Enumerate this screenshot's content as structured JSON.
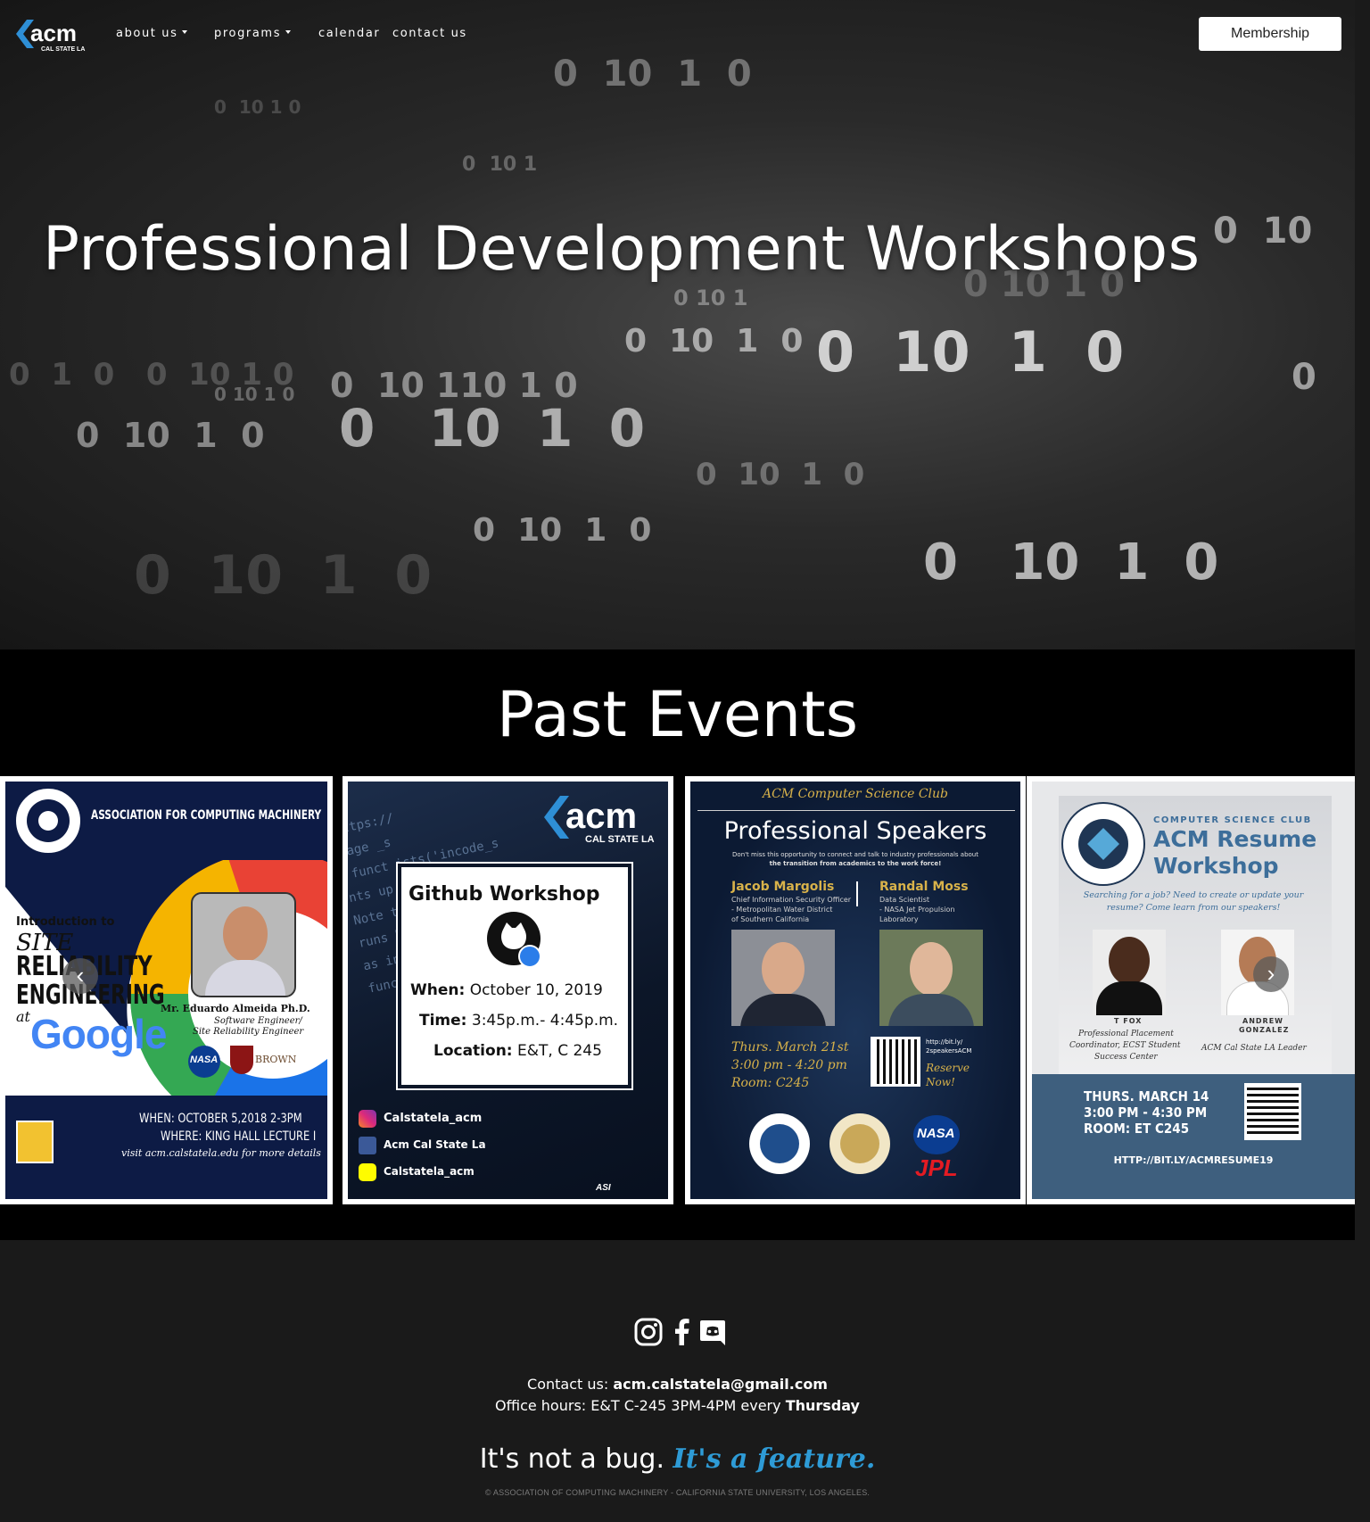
{
  "nav": {
    "logo_text": "acm",
    "logo_sub": "CAL STATE LA",
    "about": "about us",
    "programs": "programs",
    "calendar": "calendar",
    "contact": "contact us",
    "membership": "Membership"
  },
  "hero": {
    "title": "Professional Development Workshops"
  },
  "events": {
    "title": "Past Events",
    "posters": [
      {
        "org": "ASSOCIATION FOR COMPUTING MACHINERY",
        "intro": "Introduction to",
        "line1": "SITE",
        "line2": "RELIABILITY",
        "line3": "ENGINEERING",
        "at": "at",
        "company": "Google",
        "speaker": "Mr. Eduardo Almeida Ph.D.",
        "role1": "Software Engineer/",
        "role2": "Site Reliability Engineer",
        "nasa": "NASA",
        "brown": "BROWN",
        "when": "WHEN: OCTOBER 5,2018 2-3PM",
        "where": "WHERE: KING HALL LECTURE I",
        "visit": "visit acm.calstatela.edu for more details"
      },
      {
        "logo": "acm",
        "logo_sub": "CAL STATE LA",
        "title": "Github Workshop",
        "when_label": "When:",
        "when": "October 10, 2019",
        "time_label": "Time:",
        "time": "3:45p.m.- 4:45p.m.",
        "loc_label": "Location:",
        "loc": "E&T, C 245",
        "instagram": "Calstatela_acm",
        "facebook": "Acm Cal State La",
        "snapchat": "Calstatela_acm",
        "asi": "ASI"
      },
      {
        "club": "ACM Computer Science Club",
        "title": "Professional Speakers",
        "blurb1": "Don't miss this opportunity to connect and talk to industry professionals about",
        "blurb2": "the transition from academics to the work force!",
        "sp1_name": "Jacob Margolis",
        "sp1_role1": "Chief Information Security Officer",
        "sp1_role2": "- Metropolitan Water District",
        "sp1_role3": "of Southern California",
        "sp2_name": "Randal Moss",
        "sp2_role1": "Data Scientist",
        "sp2_role2": "- NASA Jet Propulsion",
        "sp2_role3": "Laboratory",
        "date": "Thurs. March 21st",
        "time": "3:00 pm - 4:20 pm",
        "room": "Room: C245",
        "link1": "http://bit.ly/",
        "link2": "2speakersACM",
        "reserve1": "Reserve",
        "reserve2": "Now!",
        "nasa": "NASA",
        "jpl": "JPL"
      },
      {
        "club": "COMPUTER SCIENCE CLUB",
        "title1": "ACM Resume",
        "title2": "Workshop",
        "q1": "Searching for a job? Need to create or update your",
        "q2": "resume? Come learn from our speakers!",
        "sp1_name": "T FOX",
        "sp1_role1": "Professional Placement",
        "sp1_role2": "Coordinator, ECST Student",
        "sp1_role3": "Success Center",
        "sp2_name1": "ANDREW",
        "sp2_name2": "GONZALEZ",
        "sp2_role": "ACM Cal State LA Leader",
        "date": "THURS. MARCH 14",
        "time": "3:00 PM - 4:30 PM",
        "room": "ROOM:  ET C245",
        "link": "HTTP://BIT.LY/ACMRESUME19"
      }
    ]
  },
  "footer": {
    "contact_label": "Contact us:",
    "email": "acm.calstatela@gmail.com",
    "hours_label": "Office hours: E&T C-245 3PM-4PM every",
    "hours_day": "Thursday",
    "tagline_a": "It's not a bug.",
    "tagline_b": "It's a feature.",
    "copyright": "© ASSOCIATION OF COMPUTING MACHINERY - CALIFORNIA STATE UNIVERSITY, LOS ANGELES."
  }
}
